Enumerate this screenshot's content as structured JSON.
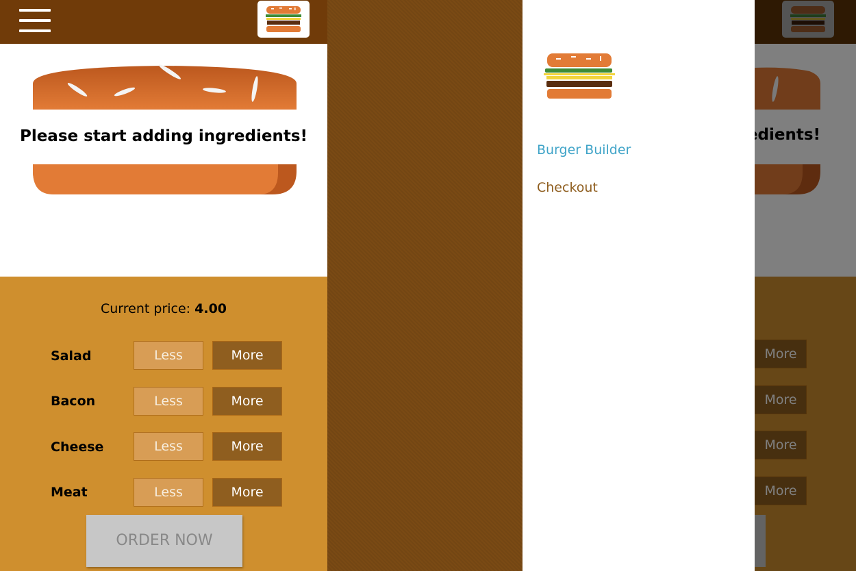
{
  "toolbar": {
    "menu_icon": "hamburger-menu-icon",
    "logo_icon": "burger-logo-icon"
  },
  "burger": {
    "message": "Please start adding ingredients!"
  },
  "build_controls": {
    "price_label": "Current price:",
    "price_value": "4.00",
    "ingredients": [
      {
        "label": "Salad",
        "less": "Less",
        "more": "More"
      },
      {
        "label": "Bacon",
        "less": "Less",
        "more": "More"
      },
      {
        "label": "Cheese",
        "less": "Less",
        "more": "More"
      },
      {
        "label": "Meat",
        "less": "Less",
        "more": "More"
      }
    ],
    "order_button": "ORDER NOW"
  },
  "drawer": {
    "nav": [
      {
        "label": "Burger Builder",
        "active": true
      },
      {
        "label": "Checkout",
        "active": false
      }
    ]
  },
  "right_panel": {
    "message_fragment": "edients!",
    "more_label": "More"
  },
  "colors": {
    "toolbar": "#703b09",
    "controls_bg": "#cf8f2e",
    "less_button": "#daa05c",
    "more_button": "#8f5e1f",
    "active_link": "#40a4c8",
    "link": "#8f5e1f",
    "bun": "#e27b36"
  }
}
